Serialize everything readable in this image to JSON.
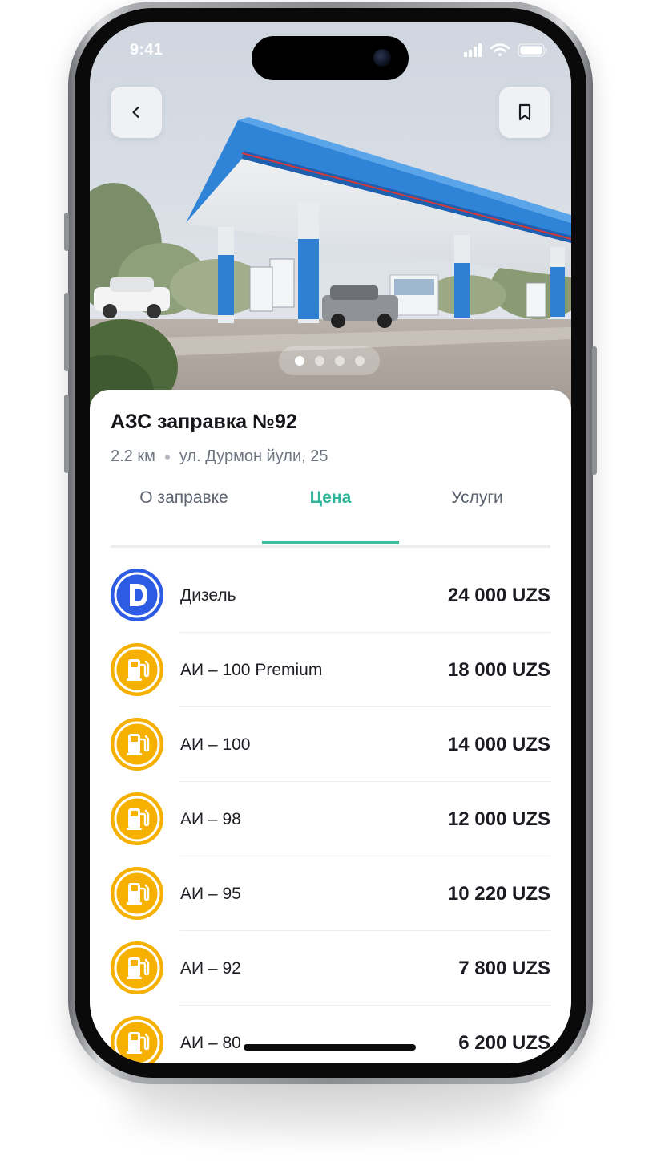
{
  "status_bar": {
    "time": "9:41"
  },
  "header": {
    "back_icon": "chevron-left-icon",
    "bookmark_icon": "bookmark-icon"
  },
  "gallery": {
    "total_dots": 4,
    "active_index": 0
  },
  "station": {
    "title": "АЗС заправка №92",
    "distance": "2.2 км",
    "address": "ул. Дурмон йули, 25"
  },
  "tabs": [
    {
      "label": "О заправке",
      "active": false
    },
    {
      "label": "Цена",
      "active": true
    },
    {
      "label": "Услуги",
      "active": false
    }
  ],
  "prices": [
    {
      "name": "Дизель",
      "price": "24 000 UZS",
      "icon": "diesel-icon",
      "color": "#2d5be3"
    },
    {
      "name": "АИ – 100 Premium",
      "price": "18 000 UZS",
      "icon": "fuel-pump-icon",
      "color": "#f6b000"
    },
    {
      "name": "АИ – 100",
      "price": "14 000 UZS",
      "icon": "fuel-pump-icon",
      "color": "#f6b000"
    },
    {
      "name": "АИ – 98",
      "price": "12 000 UZS",
      "icon": "fuel-pump-icon",
      "color": "#f6b000"
    },
    {
      "name": "АИ – 95",
      "price": "10 220 UZS",
      "icon": "fuel-pump-icon",
      "color": "#f6b000"
    },
    {
      "name": "АИ – 92",
      "price": "7 800 UZS",
      "icon": "fuel-pump-icon",
      "color": "#f6b000"
    },
    {
      "name": "АИ – 80",
      "price": "6 200 UZS",
      "icon": "fuel-pump-icon",
      "color": "#f6b000"
    }
  ],
  "colors": {
    "accent": "#3bbfa0",
    "diesel": "#2d5be3",
    "gasoline": "#f6b000"
  }
}
